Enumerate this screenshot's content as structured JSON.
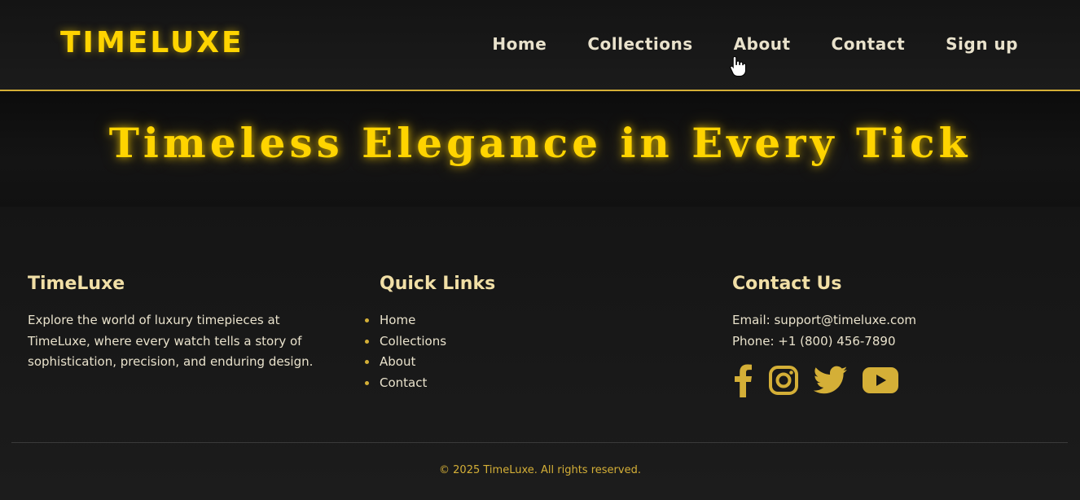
{
  "header": {
    "logo": "TIMELUXE",
    "nav": [
      {
        "label": "Home"
      },
      {
        "label": "Collections"
      },
      {
        "label": "About"
      },
      {
        "label": "Contact"
      },
      {
        "label": "Sign up"
      }
    ]
  },
  "hero": {
    "title": "Timeless Elegance in Every Tick"
  },
  "footer": {
    "brand": {
      "title": "TimeLuxe",
      "description": "Explore the world of luxury timepieces at TimeLuxe, where every watch tells a story of sophistication, precision, and enduring design."
    },
    "quick_links": {
      "title": "Quick Links",
      "items": [
        "Home",
        "Collections",
        "About",
        "Contact"
      ]
    },
    "contact": {
      "title": "Contact Us",
      "email": "Email: support@timeluxe.com",
      "phone": "Phone: +1 (800) 456-7890",
      "socials": [
        "facebook-icon",
        "instagram-icon",
        "twitter-icon",
        "youtube-icon"
      ]
    },
    "copyright": "© 2025 TimeLuxe. All rights reserved."
  },
  "theme": {
    "accent": "#d4af37",
    "logo_color": "#ffd400",
    "background": "#161616"
  }
}
